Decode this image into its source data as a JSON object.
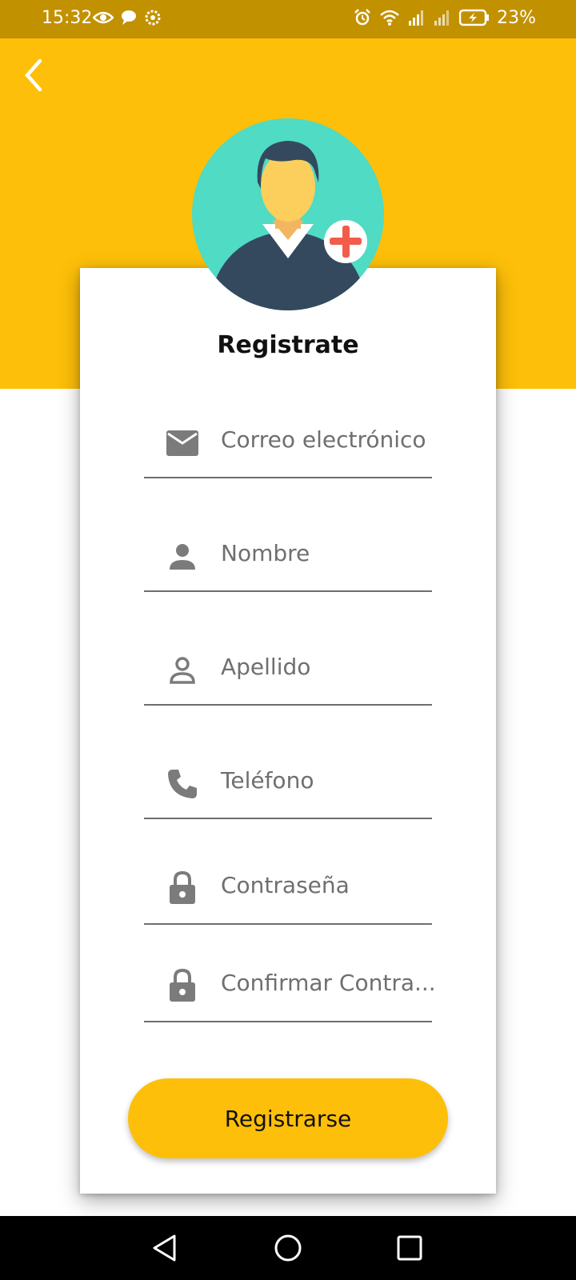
{
  "status_bar": {
    "time": "15:32",
    "battery_percent": "23%",
    "icons_left": [
      "eye-icon",
      "chat-bubble-icon",
      "settings-icon"
    ],
    "icons_right": [
      "alarm-icon",
      "wifi-icon",
      "signal-icon",
      "signal-icon",
      "battery-charging-icon"
    ]
  },
  "header": {
    "background_color": "#fdbf09",
    "back_icon": "chevron-left-icon"
  },
  "avatar": {
    "icon": "avatar-add-icon"
  },
  "form": {
    "title": "Registrate",
    "fields": [
      {
        "label": "Correo electrónico",
        "icon": "mail-icon"
      },
      {
        "label": "Nombre",
        "icon": "person-filled-icon"
      },
      {
        "label": "Apellido",
        "icon": "person-outline-icon"
      },
      {
        "label": "Teléfono",
        "icon": "phone-icon"
      },
      {
        "label": "Contraseña",
        "icon": "lock-icon"
      },
      {
        "label": "Confirmar Contra...",
        "icon": "lock-icon"
      }
    ],
    "submit_label": "Registrarse",
    "accent_color": "#fdbf09"
  },
  "nav_bar": {
    "icons": [
      "back-triangle-icon",
      "home-circle-icon",
      "recents-square-icon"
    ]
  }
}
